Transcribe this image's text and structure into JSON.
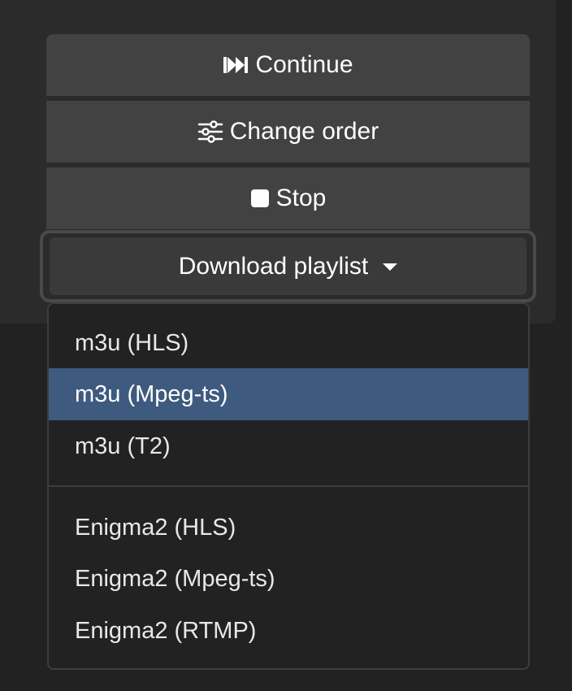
{
  "actions": {
    "continue_label": "Continue",
    "continue_icon": "fast-forward-icon",
    "change_order_label": "Change order",
    "change_order_icon": "sliders-icon",
    "stop_label": "Stop",
    "stop_icon": "stop-icon"
  },
  "download": {
    "label": "Download playlist",
    "icon": "caret-down-icon",
    "expanded": true,
    "highlighted_item": "m3u (Mpeg-ts)",
    "groups": [
      [
        "m3u (HLS)",
        "m3u (Mpeg-ts)",
        "m3u (T2)"
      ],
      [
        "Enigma2 (HLS)",
        "Enigma2 (Mpeg-ts)",
        "Enigma2 (RTMP)"
      ]
    ],
    "items": [
      "m3u (HLS)",
      "m3u (Mpeg-ts)",
      "m3u (T2)",
      "Enigma2 (HLS)",
      "Enigma2 (Mpeg-ts)",
      "Enigma2 (RTMP)"
    ]
  },
  "colors": {
    "page_background": "#222222",
    "panel_background": "#2b2b2b",
    "button_background": "#424242",
    "highlight": "#3e5a7e",
    "text": "#ffffff"
  }
}
